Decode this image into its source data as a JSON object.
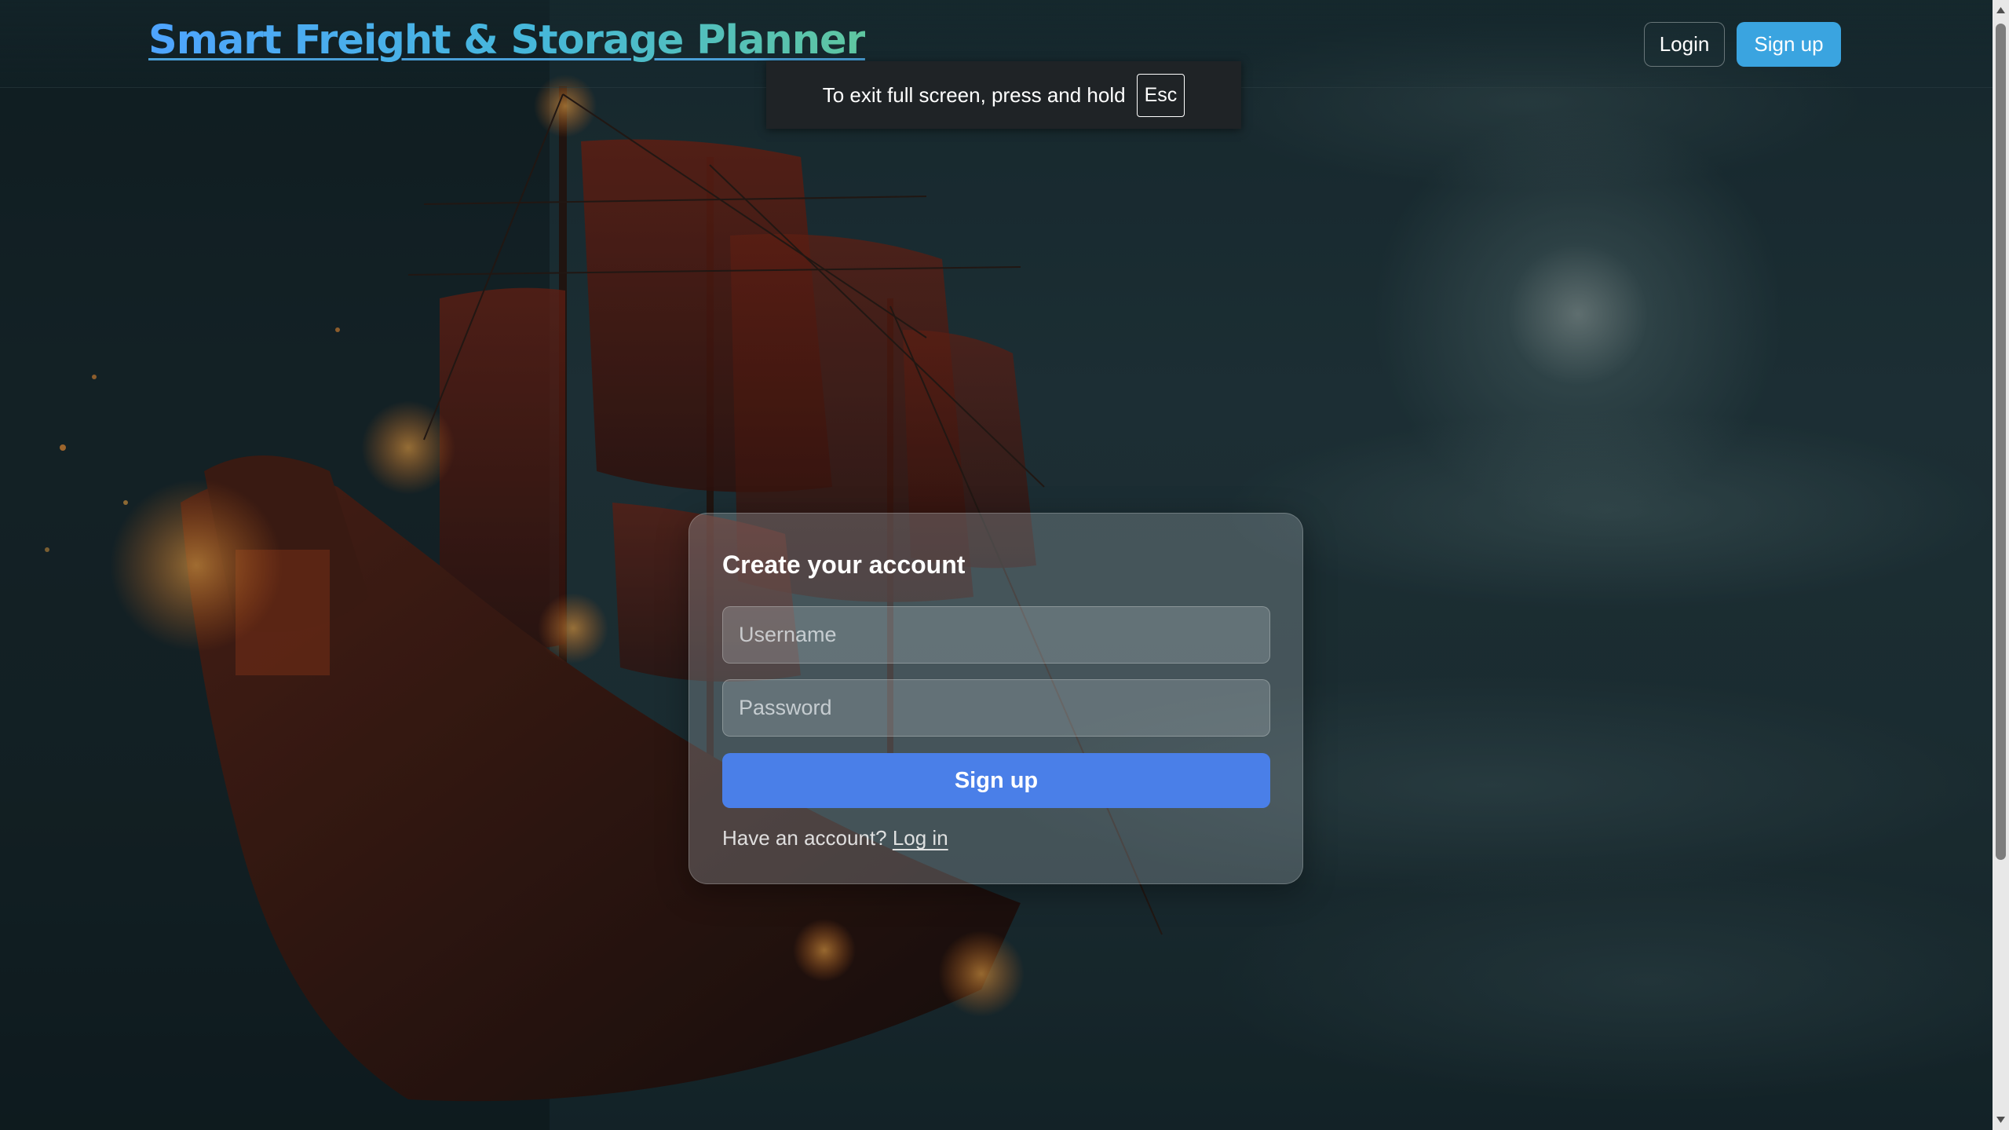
{
  "header": {
    "brand": "Smart Freight & Storage Planner",
    "login_label": "Login",
    "signup_label": "Sign up"
  },
  "fullscreen_notice": {
    "text": "To exit full screen, press and hold",
    "key": "Esc"
  },
  "signup_form": {
    "title": "Create your account",
    "username_placeholder": "Username",
    "password_placeholder": "Password",
    "submit_label": "Sign up",
    "footer_text": "Have an account?",
    "login_link": "Log in"
  },
  "colors": {
    "accent_button": "#4a7fe8",
    "nav_signup": "#3aa4e0",
    "brand_gradient_start": "#4ea4ff",
    "brand_gradient_end": "#5fc6a0"
  },
  "background": {
    "subject": "pirate ship at night under cloudy moonlit sky"
  }
}
